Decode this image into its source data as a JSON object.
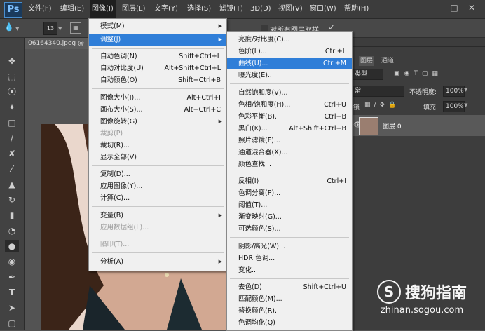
{
  "menubar": {
    "logo": "Ps",
    "items": [
      "文件(F)",
      "编辑(E)",
      "图像(I)",
      "图层(L)",
      "文字(Y)",
      "选择(S)",
      "滤镜(T)",
      "3D(D)",
      "视图(V)",
      "窗口(W)",
      "帮助(H)"
    ],
    "active_index": 2,
    "window_controls": [
      "—",
      "□",
      "✕"
    ]
  },
  "options_bar": {
    "brush_size": "13",
    "checkbox_label": "对所有图层取样"
  },
  "document": {
    "tab_label": "06164340.jpeg @"
  },
  "panel": {
    "tabs": [
      "图层",
      "通道"
    ],
    "filter_label": "类型",
    "blend_mode": "常",
    "opacity_label": "不透明度:",
    "opacity_value": "100%",
    "lock_label": "锁",
    "fill_label": "填充:",
    "fill_value": "100%",
    "layer_name": "图层 0"
  },
  "image_menu": {
    "items": [
      {
        "label": "模式(M)",
        "shortcut": "",
        "submenu": true,
        "disabled": false,
        "highlight": false
      },
      {
        "label": "调整(J)",
        "shortcut": "",
        "submenu": true,
        "disabled": false,
        "highlight": true
      },
      {
        "label": "自动色调(N)",
        "shortcut": "Shift+Ctrl+L",
        "submenu": false,
        "disabled": false,
        "highlight": false
      },
      {
        "label": "自动对比度(U)",
        "shortcut": "Alt+Shift+Ctrl+L",
        "submenu": false,
        "disabled": false,
        "highlight": false
      },
      {
        "label": "自动颜色(O)",
        "shortcut": "Shift+Ctrl+B",
        "submenu": false,
        "disabled": false,
        "highlight": false
      },
      {
        "label": "图像大小(I)...",
        "shortcut": "Alt+Ctrl+I",
        "submenu": false,
        "disabled": false,
        "highlight": false
      },
      {
        "label": "画布大小(S)...",
        "shortcut": "Alt+Ctrl+C",
        "submenu": false,
        "disabled": false,
        "highlight": false
      },
      {
        "label": "图像旋转(G)",
        "shortcut": "",
        "submenu": true,
        "disabled": false,
        "highlight": false
      },
      {
        "label": "裁剪(P)",
        "shortcut": "",
        "submenu": false,
        "disabled": true,
        "highlight": false
      },
      {
        "label": "裁切(R)...",
        "shortcut": "",
        "submenu": false,
        "disabled": false,
        "highlight": false
      },
      {
        "label": "显示全部(V)",
        "shortcut": "",
        "submenu": false,
        "disabled": false,
        "highlight": false
      },
      {
        "label": "复制(D)...",
        "shortcut": "",
        "submenu": false,
        "disabled": false,
        "highlight": false
      },
      {
        "label": "应用图像(Y)...",
        "shortcut": "",
        "submenu": false,
        "disabled": false,
        "highlight": false
      },
      {
        "label": "计算(C)...",
        "shortcut": "",
        "submenu": false,
        "disabled": false,
        "highlight": false
      },
      {
        "label": "变量(B)",
        "shortcut": "",
        "submenu": true,
        "disabled": false,
        "highlight": false
      },
      {
        "label": "应用数据组(L)...",
        "shortcut": "",
        "submenu": false,
        "disabled": true,
        "highlight": false
      },
      {
        "label": "陷印(T)...",
        "shortcut": "",
        "submenu": false,
        "disabled": true,
        "highlight": false
      },
      {
        "label": "分析(A)",
        "shortcut": "",
        "submenu": true,
        "disabled": false,
        "highlight": false
      }
    ]
  },
  "adjust_menu": {
    "items": [
      {
        "label": "亮度/对比度(C)...",
        "shortcut": "",
        "highlight": false
      },
      {
        "label": "色阶(L)...",
        "shortcut": "Ctrl+L",
        "highlight": false
      },
      {
        "label": "曲线(U)...",
        "shortcut": "Ctrl+M",
        "highlight": true
      },
      {
        "label": "曝光度(E)...",
        "shortcut": "",
        "highlight": false
      },
      {
        "label": "自然饱和度(V)...",
        "shortcut": "",
        "highlight": false
      },
      {
        "label": "色相/饱和度(H)...",
        "shortcut": "Ctrl+U",
        "highlight": false
      },
      {
        "label": "色彩平衡(B)...",
        "shortcut": "Ctrl+B",
        "highlight": false
      },
      {
        "label": "黑白(K)...",
        "shortcut": "Alt+Shift+Ctrl+B",
        "highlight": false
      },
      {
        "label": "照片滤镜(F)...",
        "shortcut": "",
        "highlight": false
      },
      {
        "label": "通道混合器(X)...",
        "shortcut": "",
        "highlight": false
      },
      {
        "label": "颜色查找...",
        "shortcut": "",
        "highlight": false
      },
      {
        "label": "反相(I)",
        "shortcut": "Ctrl+I",
        "highlight": false
      },
      {
        "label": "色调分离(P)...",
        "shortcut": "",
        "highlight": false
      },
      {
        "label": "阈值(T)...",
        "shortcut": "",
        "highlight": false
      },
      {
        "label": "渐变映射(G)...",
        "shortcut": "",
        "highlight": false
      },
      {
        "label": "可选颜色(S)...",
        "shortcut": "",
        "highlight": false
      },
      {
        "label": "阴影/高光(W)...",
        "shortcut": "",
        "highlight": false
      },
      {
        "label": "HDR 色调...",
        "shortcut": "",
        "highlight": false
      },
      {
        "label": "变化...",
        "shortcut": "",
        "highlight": false
      },
      {
        "label": "去色(D)",
        "shortcut": "Shift+Ctrl+U",
        "highlight": false
      },
      {
        "label": "匹配颜色(M)...",
        "shortcut": "",
        "highlight": false
      },
      {
        "label": "替换颜色(R)...",
        "shortcut": "",
        "highlight": false
      },
      {
        "label": "色调均化(Q)",
        "shortcut": "",
        "highlight": false
      }
    ]
  },
  "watermark": {
    "brand": "搜狗指南",
    "url": "zhinan.sogou.com"
  }
}
